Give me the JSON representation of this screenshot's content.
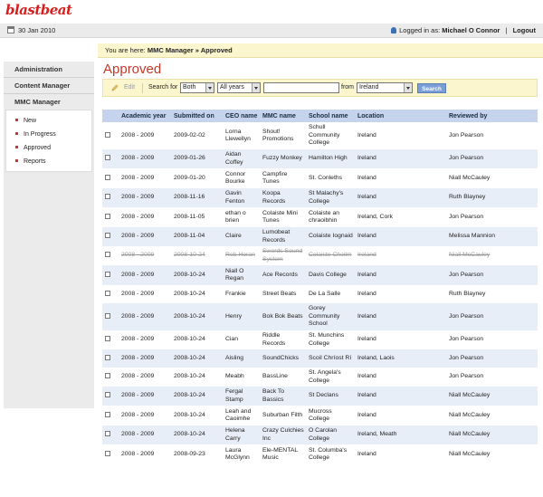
{
  "app": {
    "logo": "blastbeat"
  },
  "topbar": {
    "date": "30 Jan 2010",
    "logged_in_label": "Logged in as:",
    "user_name": "Michael O Connor",
    "separator": "|",
    "logout": "Logout"
  },
  "breadcrumb": {
    "prefix": "You are here:",
    "path": "MMC Manager » Approved"
  },
  "sidebar": {
    "sections": [
      "Administration",
      "Content Manager",
      "MMC Manager"
    ],
    "items": [
      "New",
      "In Progress",
      "Approved",
      "Reports"
    ]
  },
  "page": {
    "title": "Approved"
  },
  "toolbar": {
    "edit": "Edit",
    "search_for": "Search for",
    "search_type": "Both",
    "year_filter": "All years",
    "search_value": "",
    "from_label": "from",
    "country": "Ireland",
    "search_button": "Search"
  },
  "table": {
    "columns": [
      "Academic year",
      "Submitted on",
      "CEO name",
      "MMC name",
      "School name",
      "Location",
      "Reviewed by"
    ],
    "rows": [
      [
        "2008 - 2009",
        "2009-02-02",
        "Lorna Llewellyn",
        "Shout! Promotions",
        "Schull Community College",
        "Ireland",
        "Jon Pearson"
      ],
      [
        "2008 - 2009",
        "2009-01-26",
        "Aidan Coffey",
        "Fuzzy Monkey",
        "Hamilton High",
        "Ireland",
        "Jon Pearson"
      ],
      [
        "2008 - 2009",
        "2009-01-20",
        "Connor Bourke",
        "Campfire Tunes",
        "St. Conleths",
        "Ireland",
        "Niall McCauley"
      ],
      [
        "2008 - 2009",
        "2008-11-16",
        "Gavin Fenton",
        "Koopa Records",
        "St Malachy's College",
        "Ireland",
        "Ruth Blayney"
      ],
      [
        "2008 - 2009",
        "2008-11-05",
        "ethan o brien",
        "Colaiste Mini Tunes",
        "Colaiste an chraoibhin",
        "Ireland, Cork",
        "Jon Pearson"
      ],
      [
        "2008 - 2009",
        "2008-11-04",
        "Claire",
        "Lumobeat Records",
        "Colaiste Iognaid",
        "Ireland",
        "Melissa Mannion"
      ],
      [
        "2008 - 2009",
        "2008-10-24",
        "Rob Horan",
        "Swords Sound System",
        "Colaiste Choilm",
        "Ireland",
        "Niall McCauley"
      ],
      [
        "2008 - 2009",
        "2008-10-24",
        "Niall O Regan",
        "Ace Records",
        "Davis College",
        "Ireland",
        "Jon Pearson"
      ],
      [
        "2008 - 2009",
        "2008-10-24",
        "Frankie",
        "Street Beats",
        "De La Salle",
        "Ireland",
        "Ruth Blayney"
      ],
      [
        "2008 - 2009",
        "2008-10-24",
        "Henry",
        "Bok Bok Beats",
        "Gorey Community School",
        "Ireland",
        "Jon Pearson"
      ],
      [
        "2008 - 2009",
        "2008-10-24",
        "Cian",
        "Riddle Records",
        "St. Munchins College",
        "Ireland",
        "Jon Pearson"
      ],
      [
        "2008 - 2009",
        "2008-10-24",
        "Aisling",
        "SoundChicks",
        "Scoil Chríost Rí",
        "Ireland, Laois",
        "Jon Pearson"
      ],
      [
        "2008 - 2009",
        "2008-10-24",
        "Meabh",
        "BassLine",
        "St. Angela's College",
        "Ireland",
        "Jon Pearson"
      ],
      [
        "2008 - 2009",
        "2008-10-24",
        "Fergal Stamp",
        "Back To Bassics",
        "St Declans",
        "Ireland",
        "Niall McCauley"
      ],
      [
        "2008 - 2009",
        "2008-10-24",
        "Leah and Caoimhe",
        "Suburban Filth",
        "Mucross College",
        "Ireland",
        "Niall McCauley"
      ],
      [
        "2008 - 2009",
        "2008-10-24",
        "Helena Carry",
        "Crazy Culchies Inc",
        "O Carolan College",
        "Ireland, Meath",
        "Niall McCauley"
      ],
      [
        "2008 - 2009",
        "2008-09-23",
        "Laura McGlynn",
        "Ele-MENTAL Music",
        "St. Columba's College",
        "Ireland",
        "Niall McCauley"
      ]
    ],
    "struck_row_index": 6
  },
  "colors": {
    "brand": "#d62020",
    "accent": "#c0392b",
    "header_bg": "#c5d4ec",
    "notice_bg": "#fcf6cf",
    "button": "#7a9ed6"
  },
  "icons": {
    "date": "calendar-icon",
    "user": "user-icon",
    "edit": "pencil-icon"
  }
}
